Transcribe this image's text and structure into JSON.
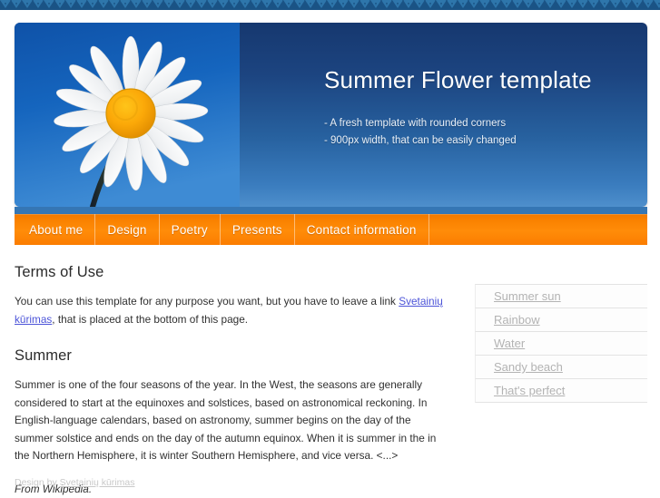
{
  "window": {
    "background_color": "#ffffff"
  },
  "top_pattern": {
    "name": "decorative-tribal-band",
    "color_dark": "#1a5385",
    "color_light": "#2e76ab"
  },
  "header": {
    "title": "Summer Flower template",
    "taglines": [
      "- A fresh template with rounded corners",
      "- 900px width, that can be easily changed"
    ],
    "gradient_top": "#16386f",
    "gradient_bottom": "#4e8fcc",
    "photo_alt": "white daisy flower on blue sky"
  },
  "nav": {
    "accent_color": "#fa8200",
    "items": [
      {
        "label": "About me"
      },
      {
        "label": "Design"
      },
      {
        "label": "Poetry"
      },
      {
        "label": "Presents"
      },
      {
        "label": "Contact information"
      }
    ]
  },
  "main": {
    "terms": {
      "heading": "Terms of Use",
      "text_before_link": "You can use this template for any purpose you want, but you have to leave a link ",
      "link_text": "Svetainių kūrimas",
      "text_after_link": ", that is placed at the bottom of this page."
    },
    "summer": {
      "heading": "Summer",
      "paragraph": "Summer is one of the four seasons of the year. In the West, the seasons are generally considered to start at the equinoxes and solstices, based on astronomical reckoning. In English-language calendars, based on astronomy, summer begins on the day of the summer solstice and ends on the day of the autumn equinox. When it is summer in the in the Northern Hemisphere, it is winter Southern Hemisphere, and vice versa. <...>",
      "attribution": "From Wikipedia."
    }
  },
  "sidebar": {
    "items": [
      {
        "label": "Summer sun"
      },
      {
        "label": "Rainbow"
      },
      {
        "label": "Water"
      },
      {
        "label": "Sandy beach"
      },
      {
        "label": "That's perfect"
      }
    ]
  },
  "footer": {
    "prefix": "Design by ",
    "link_text": "Svetainių kūrimas"
  }
}
